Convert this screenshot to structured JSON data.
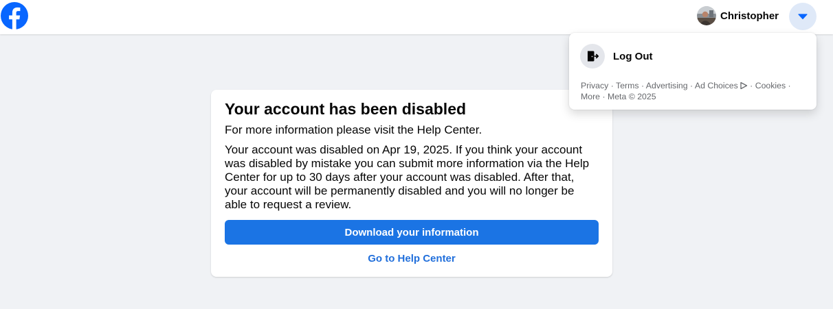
{
  "header": {
    "logo_icon": "facebook-logo-icon",
    "brand_color": "#0866ff",
    "profile": {
      "name": "Christopher",
      "avatar_icon": "user-avatar"
    },
    "menu_button_icon": "caret-down-icon"
  },
  "account_menu": {
    "logout_label": "Log Out",
    "logout_icon": "logout-door-icon",
    "footer": {
      "privacy": "Privacy",
      "terms": "Terms",
      "advertising": "Advertising",
      "ad_choices": "Ad Choices",
      "cookies": "Cookies",
      "more": "More",
      "meta": "Meta © 2025",
      "separator": " · "
    }
  },
  "card": {
    "title": "Your account has been disabled",
    "subtitle": "For more information please visit the Help Center.",
    "body": "Your account was disabled on Apr 19, 2025. If you think your account was disabled by mistake you can submit more information via the Help Center for up to 30 days after your account was disabled. After that, your account will be permanently disabled and you will no longer be able to request a review.",
    "download_button_label": "Download your information",
    "help_center_link": "Go to Help Center"
  },
  "colors": {
    "page_background": "#f0f2f5",
    "primary_button": "#1b74e4",
    "link": "#216fdb",
    "menu_button_bg": "#dfe9f8"
  }
}
